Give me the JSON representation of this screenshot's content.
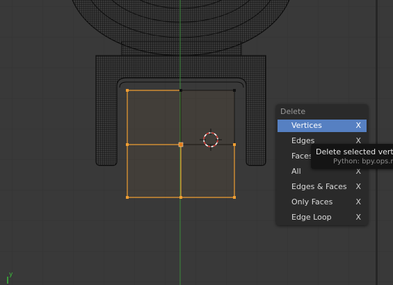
{
  "viewport": {
    "axis_label": "y"
  },
  "menu": {
    "title": "Delete",
    "items": [
      {
        "label": "Vertices",
        "shortcut": "X",
        "active": true
      },
      {
        "label": "Edges",
        "shortcut": "X"
      },
      {
        "label": "Faces",
        "shortcut": "X"
      },
      {
        "label": "All",
        "shortcut": "X"
      },
      {
        "label": "Edges & Faces",
        "shortcut": "X"
      },
      {
        "label": "Only Faces",
        "shortcut": "X"
      },
      {
        "label": "Edge Loop",
        "shortcut": "X"
      }
    ]
  },
  "tooltip": {
    "description": "Delete selected vertic",
    "python": "Python: bpy.ops.m"
  },
  "colors": {
    "background": "#393939",
    "selection": "#f09e32",
    "menu_highlight": "#5680c2",
    "y_axis": "#3a8a3a"
  }
}
